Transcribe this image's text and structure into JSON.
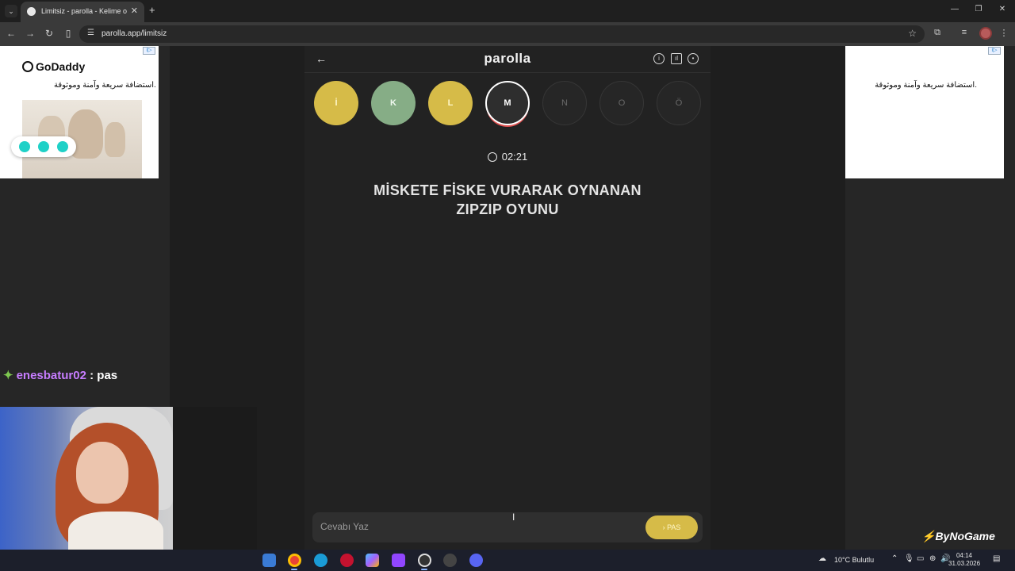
{
  "browser": {
    "tab_title": "Limitsiz - parolla - Kelime oyunu",
    "url": "parolla.app/limitsiz"
  },
  "ads": {
    "left_brand": "GoDaddy",
    "left_tagline": "استضافة سريعة وآمنة وموثوقة.",
    "right_tagline": "استضافة سريعة وآمنة وموثوقة."
  },
  "game": {
    "title": "parolla",
    "letters": [
      {
        "char": "İ",
        "state": "yellow"
      },
      {
        "char": "K",
        "state": "green"
      },
      {
        "char": "L",
        "state": "yellow"
      },
      {
        "char": "M",
        "state": "active"
      },
      {
        "char": "N",
        "state": "pending"
      },
      {
        "char": "O",
        "state": "pending"
      },
      {
        "char": "Ö",
        "state": "pending"
      }
    ],
    "timer": "02:21",
    "question_line1": "MİSKETE FİSKE VURARAK OYNANAN",
    "question_line2": "ZIPZIP OYUNU",
    "answer_placeholder": "Cevabı Yaz",
    "pass_label": "PAS"
  },
  "stream": {
    "chat_user": "enesbatur02",
    "chat_message": ": pas",
    "watermark": "ByNoGame"
  },
  "taskbar": {
    "weather": "10°C Bulutlu",
    "time": "04:14",
    "date": "31.03.2026"
  },
  "colors": {
    "yellow": "#d6bb48",
    "green": "#86ad86",
    "active_ring": "#e05050"
  }
}
